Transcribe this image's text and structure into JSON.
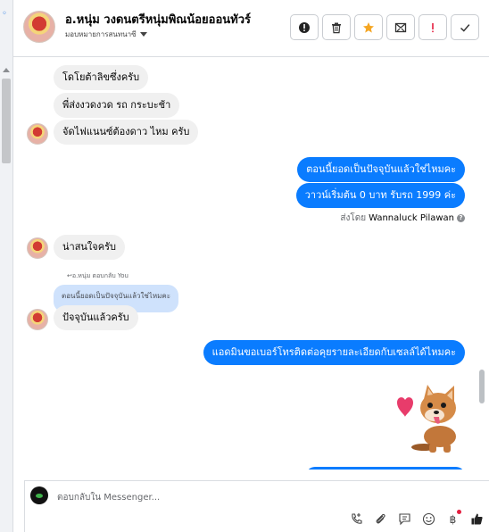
{
  "header": {
    "title": "อ.หนุ่ม วงดนตรีหนุ่มพิณน้อยออนทัวร์",
    "assign_label": "มอบหมายการสนทนาซี",
    "actions": [
      "alert-circle",
      "trash",
      "star",
      "mail-x",
      "exclamation",
      "check"
    ],
    "star_color": "#f5a623",
    "alert_color": "#e41e3f"
  },
  "messages": {
    "m1": "โดโยต้าลิขซึ่งครับ",
    "m2": "พี่ส่งงวดงวด  รถ กระบะช้า",
    "m3": "จัดไฟแนนซ์ต้องดาว ไหม ครับ",
    "o1": "ตอนนี้ยอดเป็นปัจจุบันแล้วใช่ไหมคะ",
    "o2": "วาวน์เริ่มต้น 0 บาท รับรถ 1999 ค่ะ",
    "sent_by_prefix": "ส่งโดย",
    "sent_by_name": "Wannaluck Pilawan",
    "m4": "น่าสนใจครับ",
    "reply_header": "↩อ.หนุ่ม ตอบกลับ You",
    "reply_quote": "ตอนนี้ยอดเป็นปัจจุบันแล้วใช่ไหมคะ",
    "m5": "ปัจจุบันแล้วครับ",
    "o3": "แอดมินขอเบอร์โทรติดต่อคุยรายละเอียดกับเซลล์ได้ไหมคะ",
    "sticker": "corgi-heart-sticker"
  },
  "composer": {
    "placeholder": "ตอบกลับใน Messenger...",
    "tools": [
      "call-plus",
      "attach",
      "saved-replies",
      "emoji",
      "baht",
      "like"
    ],
    "accent": "#0a7cff"
  }
}
